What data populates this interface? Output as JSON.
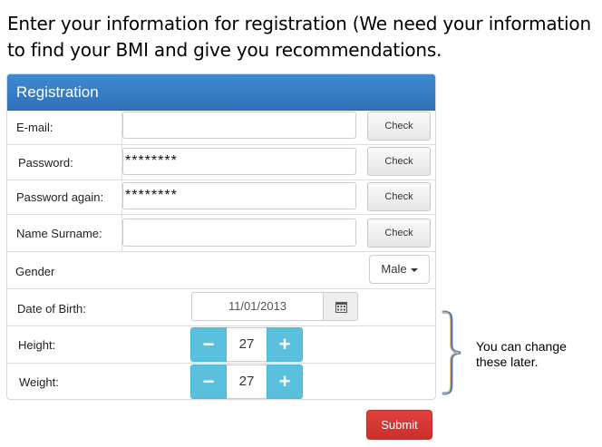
{
  "intro": {
    "text": "Enter your information for registration (We need your information to find your BMI and give you recommendations."
  },
  "panel": {
    "title": "Registration"
  },
  "fields": {
    "email": {
      "label": "E-mail:",
      "value": "",
      "check_label": "Check"
    },
    "password": {
      "label": "Password:",
      "value": "********",
      "check_label": "Check"
    },
    "password_again": {
      "label": "Password again:",
      "value": "********",
      "check_label": "Check"
    },
    "name_surname": {
      "label": "Name Surname:",
      "value": "",
      "check_label": "Check"
    },
    "gender": {
      "label": "Gender",
      "selected": "Male"
    },
    "date_of_birth": {
      "label": "Date of Birth:",
      "value": "11/01/2013",
      "icon": "calendar-icon"
    },
    "height": {
      "label": "Height:",
      "value": "27",
      "minus": "−",
      "plus": "+"
    },
    "weight": {
      "label": "Weight:",
      "value": "27",
      "minus": "−",
      "plus": "+"
    }
  },
  "annotation": {
    "note": "You can change these later.",
    "icon": "curly-brace-icon"
  },
  "submit": {
    "label": "Submit"
  },
  "colors": {
    "panel_header": "#337ab7",
    "stepper": "#5bc0de",
    "submit": "#d9534f"
  }
}
